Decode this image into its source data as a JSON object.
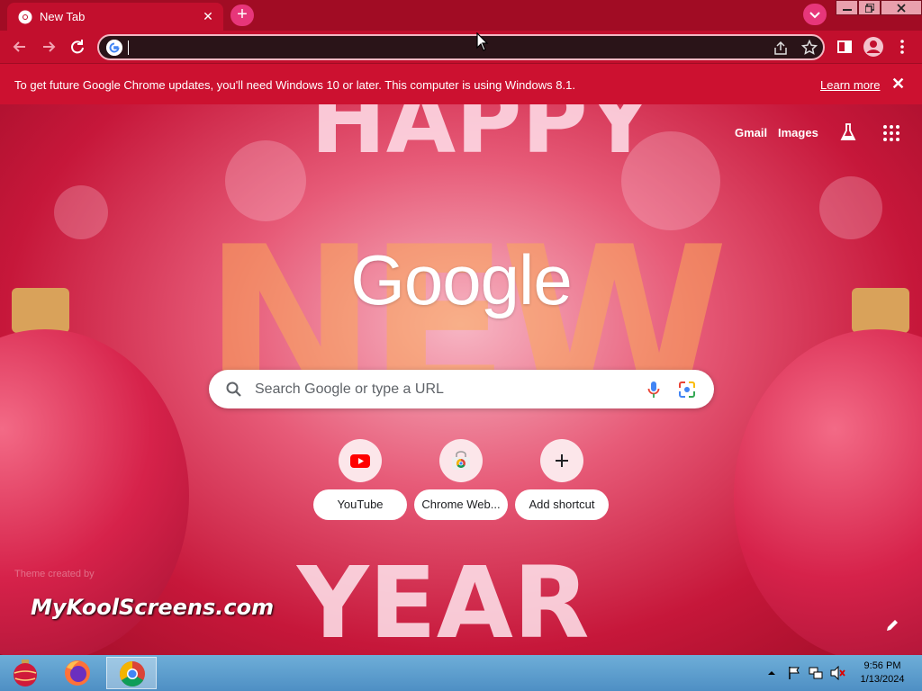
{
  "browser": {
    "tab": {
      "title": "New Tab",
      "favicon": "chrome-icon"
    },
    "new_tab_icon": "plus-icon",
    "tab_search_icon": "chevron-down-icon",
    "window_controls": [
      "minimize-icon",
      "restore-icon",
      "close-icon"
    ],
    "omnibox": {
      "value": "",
      "placeholder": ""
    },
    "accent_color": "#c20f2d"
  },
  "infobar": {
    "message": "To get future Google Chrome updates, you'll need Windows 10 or later. This computer is using Windows 8.1.",
    "link": "Learn more"
  },
  "ntp": {
    "top_links": {
      "gmail": "Gmail",
      "images": "Images"
    },
    "logo": "Google",
    "search_placeholder": "Search Google or type a URL",
    "shortcuts": [
      {
        "label": "YouTube",
        "icon": "youtube-icon"
      },
      {
        "label": "Chrome Web...",
        "icon": "chrome-web-store-icon"
      },
      {
        "label": "Add shortcut",
        "icon": "plus-icon"
      }
    ],
    "theme_credit": "Theme created by",
    "watermark": "MyKoolScreens.com",
    "theme_decoration": {
      "top": "HAPPY",
      "middle": "NEW",
      "bottom": "YEAR"
    }
  },
  "taskbar": {
    "apps": [
      "ornament-start-icon",
      "firefox-icon",
      "chrome-icon"
    ],
    "time": "9:56 PM",
    "date": "1/13/2024"
  }
}
